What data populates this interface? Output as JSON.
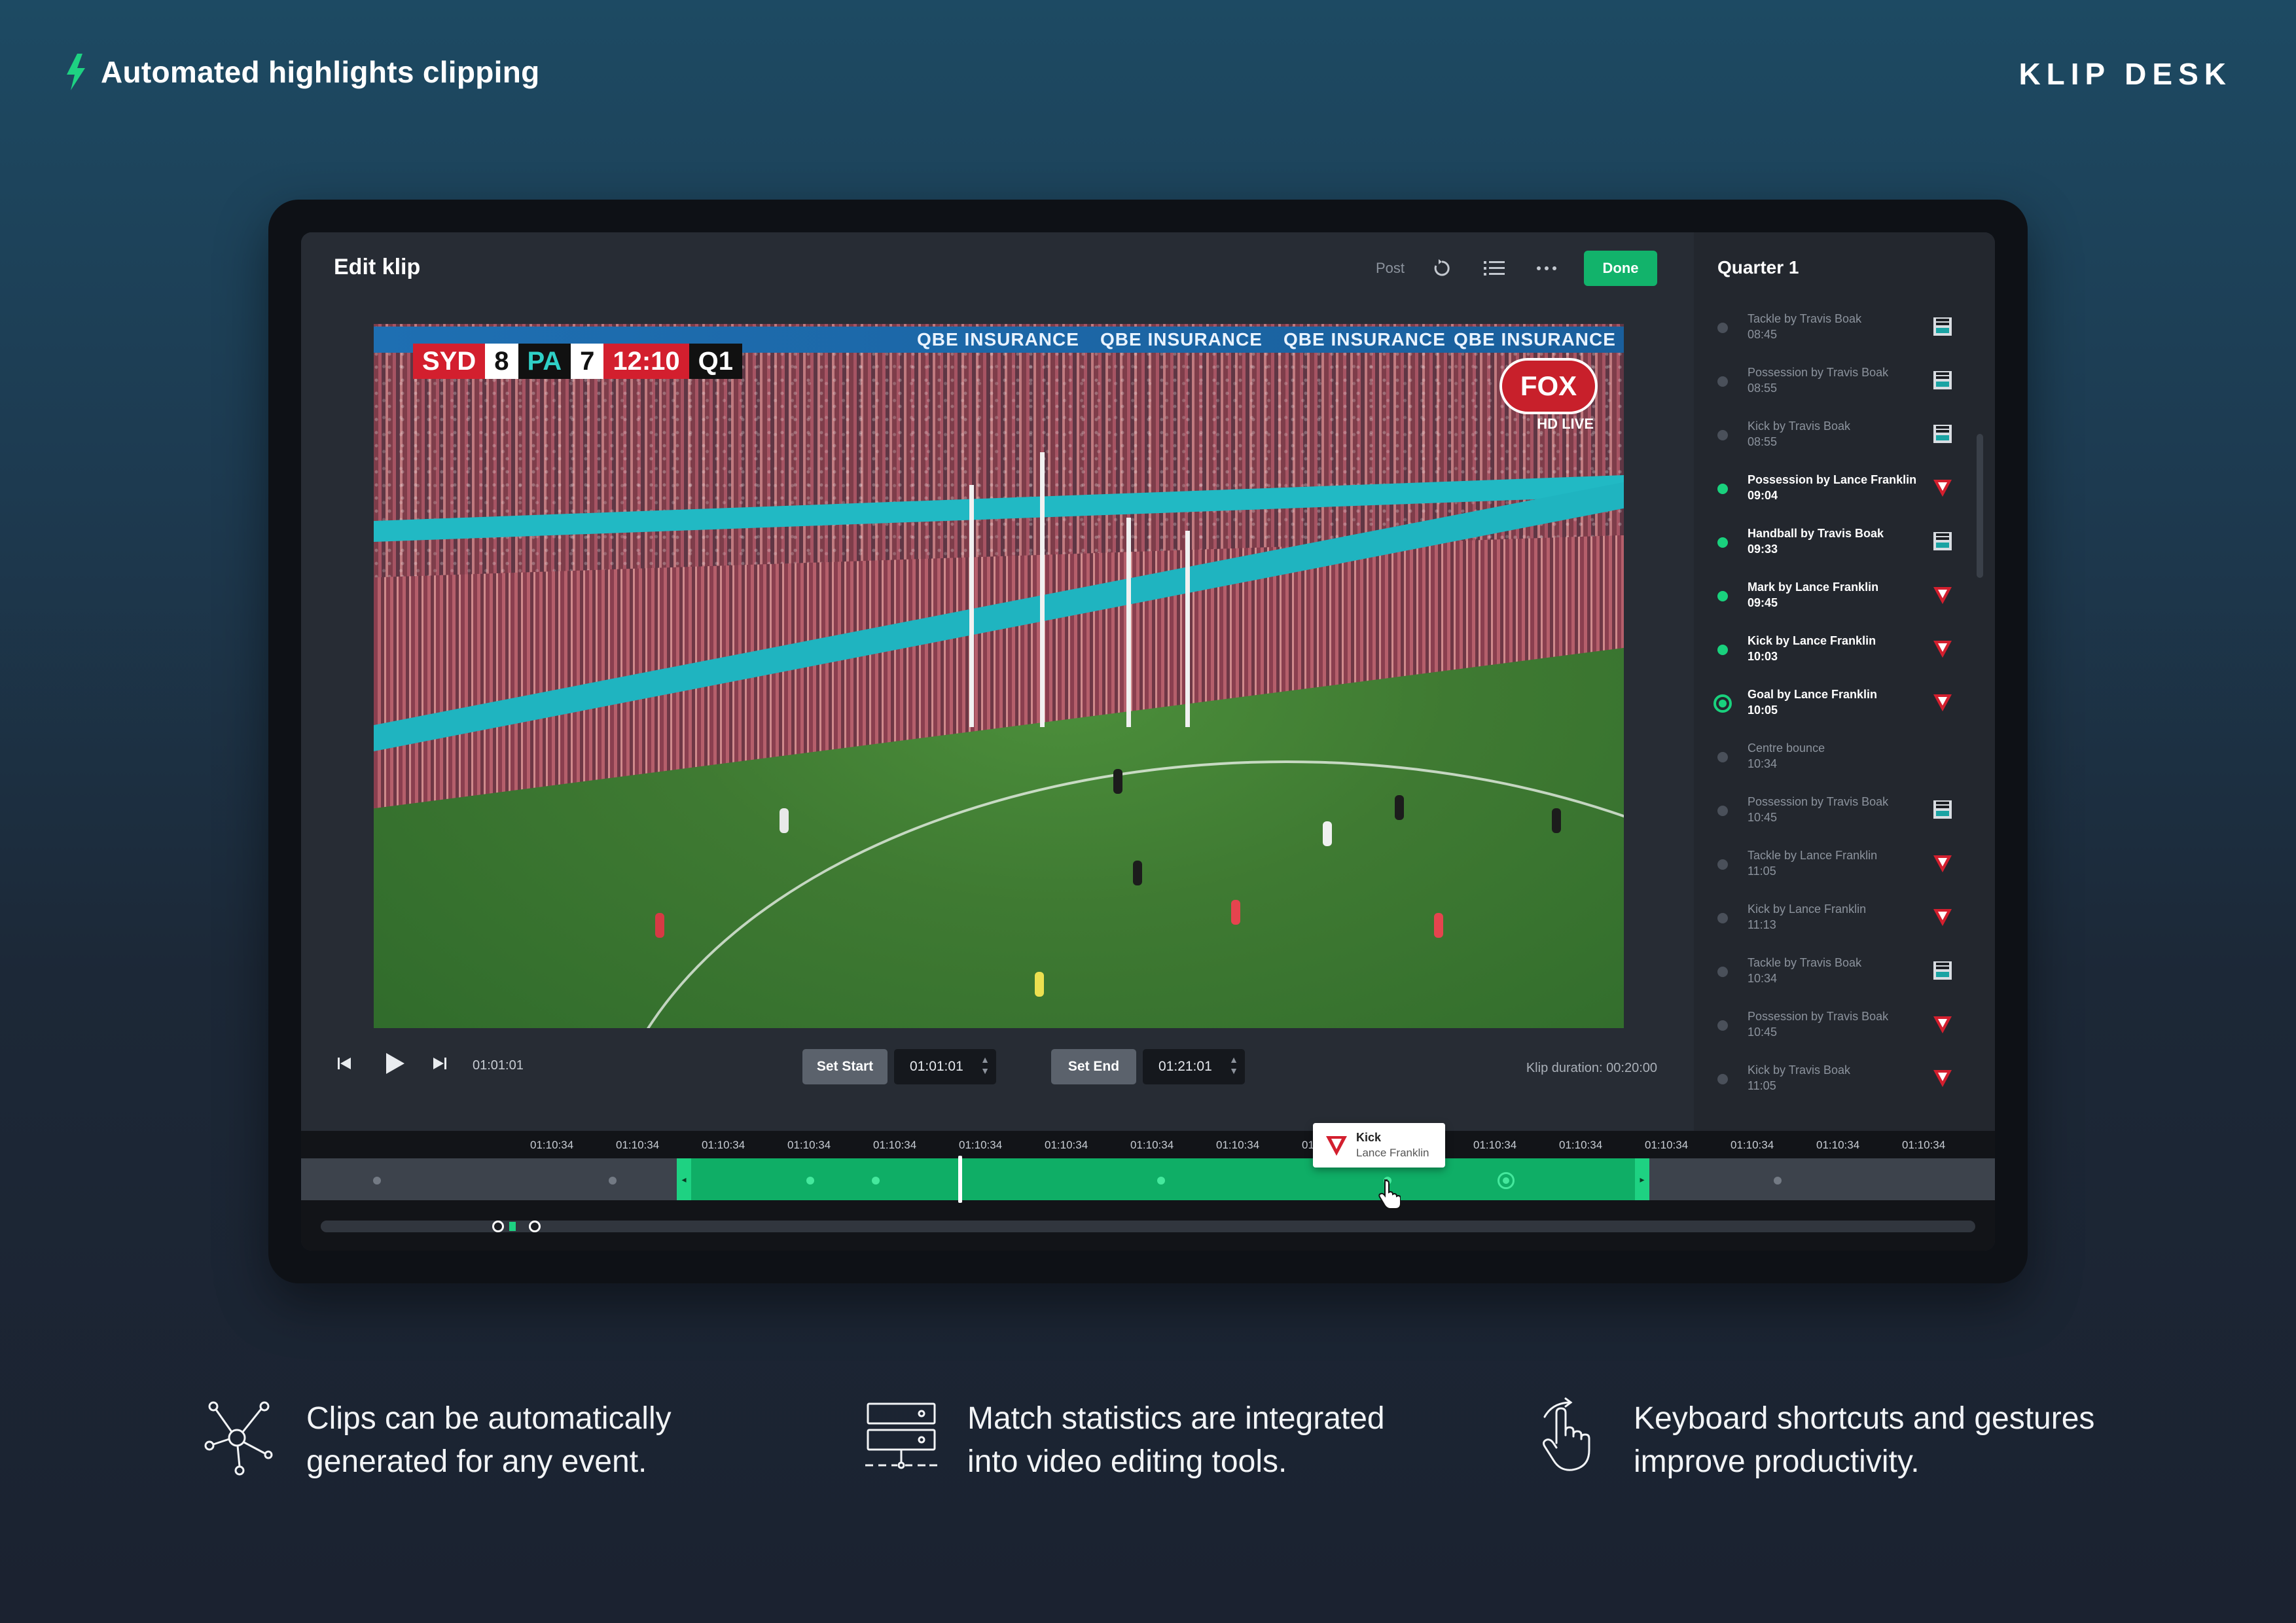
{
  "header": {
    "tagline": "Automated highlights clipping",
    "logo": "KLIP DESK",
    "accent": "#1ed282"
  },
  "editor": {
    "title": "Edit klip",
    "toolbar": {
      "post_label": "Post",
      "icons": [
        "undo-icon",
        "list-icon",
        "more-icon"
      ],
      "done_label": "Done"
    }
  },
  "video": {
    "scorebug": {
      "home": "SYD",
      "home_score": "8",
      "away": "PA",
      "away_score": "7",
      "clock": "12:10",
      "quarter": "Q1"
    },
    "ad_text": "QBE INSURANCE",
    "broadcaster": "FOX",
    "broadcast_tag": "HD LIVE"
  },
  "controls": {
    "current_time": "01:01:01",
    "set_start_label": "Set Start",
    "start_time": "01:01:01",
    "set_end_label": "Set End",
    "end_time": "01:21:01",
    "klip_duration": "Klip duration: 00:20:00"
  },
  "sidebar": {
    "title": "Quarter 1",
    "events": [
      {
        "name": "Tackle by Travis Boak",
        "time": "08:45",
        "team": "PA",
        "state": "inactive"
      },
      {
        "name": "Possession by Travis Boak",
        "time": "08:55",
        "team": "PA",
        "state": "inactive"
      },
      {
        "name": "Kick by Travis Boak",
        "time": "08:55",
        "team": "PA",
        "state": "inactive"
      },
      {
        "name": "Possession by Lance Franklin",
        "time": "09:04",
        "team": "SYD",
        "state": "active"
      },
      {
        "name": "Handball by Travis Boak",
        "time": "09:33",
        "team": "PA",
        "state": "active"
      },
      {
        "name": "Mark by Lance Franklin",
        "time": "09:45",
        "team": "SYD",
        "state": "active"
      },
      {
        "name": "Kick by Lance Franklin",
        "time": "10:03",
        "team": "SYD",
        "state": "active"
      },
      {
        "name": "Goal by Lance Franklin",
        "time": "10:05",
        "team": "SYD",
        "state": "current"
      },
      {
        "name": "Centre bounce",
        "time": "10:34",
        "team": "",
        "state": "inactive"
      },
      {
        "name": "Possession by Travis Boak",
        "time": "10:45",
        "team": "PA",
        "state": "inactive"
      },
      {
        "name": "Tackle by Lance Franklin",
        "time": "11:05",
        "team": "SYD",
        "state": "inactive"
      },
      {
        "name": "Kick by Lance Franklin",
        "time": "11:13",
        "team": "SYD",
        "state": "inactive"
      },
      {
        "name": "Tackle by Travis Boak",
        "time": "10:34",
        "team": "PA",
        "state": "inactive"
      },
      {
        "name": "Possession by Travis Boak",
        "time": "10:45",
        "team": "SYD",
        "state": "inactive"
      },
      {
        "name": "Kick by Travis Boak",
        "time": "11:05",
        "team": "SYD",
        "state": "inactive"
      }
    ]
  },
  "timeline": {
    "ticks": [
      "01:10:34",
      "01:10:34",
      "01:10:34",
      "01:10:34",
      "01:10:34",
      "01:10:34",
      "01:10:34",
      "01:10:34",
      "01:10:34",
      "01:10:34",
      "01:10:34",
      "01:10:34",
      "01:10:34",
      "01:10:34",
      "01:10:34",
      "01:10:34",
      "01:10:34"
    ],
    "tooltip": {
      "type": "Kick",
      "player": "Lance Franklin"
    }
  },
  "features": [
    {
      "icon": "network-icon",
      "text": "Clips can be automatically generated for any event."
    },
    {
      "icon": "server-icon",
      "text": "Match statistics are integrated into video editing tools."
    },
    {
      "icon": "gesture-hand-icon",
      "text": "Keyboard shortcuts and gestures improve productivity."
    }
  ]
}
